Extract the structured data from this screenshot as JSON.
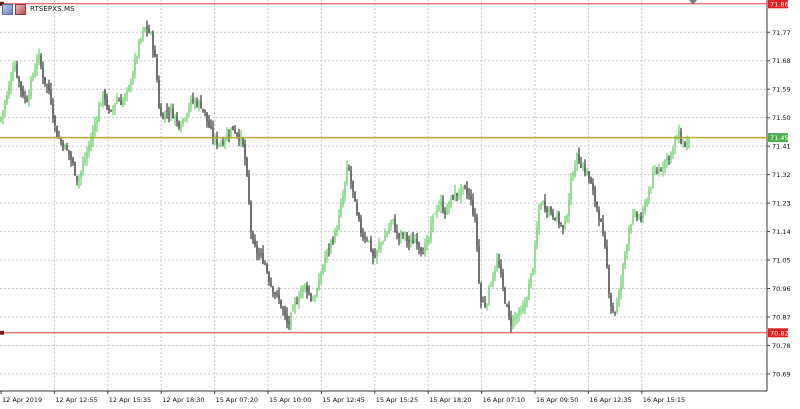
{
  "window": {
    "symbol": "RTSEPXS.MS"
  },
  "icons": {
    "symbol_icon": "chart-window-icon",
    "close_icon": "close-chart-icon"
  },
  "colors": {
    "background": "#ffffff",
    "grid": "#c7c7c7",
    "candle_up": "#4cc94c",
    "candle_down": "#111111",
    "resistance_line": "#e04040",
    "support_line": "#e04040",
    "bid_line": "#b8a43c",
    "bid_label_bg": "#4cae4c",
    "level_label_bg": "#e02020"
  },
  "price_axis": {
    "ticks": [
      "71.77",
      "71.68",
      "71.59",
      "71.50",
      "71.41",
      "71.32",
      "71.23",
      "71.14",
      "71.05",
      "70.96",
      "70.87",
      "70.78",
      "70.69"
    ],
    "range": [
      70.636,
      71.872
    ]
  },
  "time_axis": {
    "labels": [
      "12 Apr 2019",
      "12 Apr 12:55",
      "12 Apr 15:35",
      "12 Apr 18:30",
      "15 Apr 07:20",
      "15 Apr 10:00",
      "15 Apr 12:45",
      "15 Apr 15:25",
      "15 Apr 18:20",
      "16 Apr 07:10",
      "16 Apr 09:50",
      "16 Apr 12:35",
      "16 Apr 15:15"
    ]
  },
  "chart_data": {
    "type": "candlestick",
    "symbol": "RTSEPXS.MS",
    "ylim": [
      70.636,
      71.872
    ],
    "grid": true,
    "horizontal_lines": [
      {
        "price": 71.86,
        "label": "71.86"
      },
      {
        "price": 71.437,
        "label": "71.45"
      },
      {
        "price": 70.82,
        "label": "70.82"
      }
    ],
    "path": [
      [
        0,
        71.49
      ],
      [
        8,
        71.58
      ],
      [
        14,
        71.68
      ],
      [
        20,
        71.6
      ],
      [
        26,
        71.55
      ],
      [
        32,
        71.62
      ],
      [
        38,
        71.7
      ],
      [
        44,
        71.62
      ],
      [
        50,
        71.58
      ],
      [
        56,
        71.45
      ],
      [
        62,
        71.42
      ],
      [
        70,
        71.38
      ],
      [
        78,
        71.3
      ],
      [
        86,
        71.38
      ],
      [
        92,
        71.44
      ],
      [
        98,
        71.52
      ],
      [
        104,
        71.58
      ],
      [
        110,
        71.5
      ],
      [
        116,
        71.56
      ],
      [
        122,
        71.55
      ],
      [
        128,
        71.58
      ],
      [
        134,
        71.66
      ],
      [
        140,
        71.74
      ],
      [
        146,
        71.79
      ],
      [
        152,
        71.75
      ],
      [
        156,
        71.66
      ],
      [
        160,
        71.5
      ],
      [
        166,
        71.52
      ],
      [
        172,
        71.52
      ],
      [
        178,
        71.48
      ],
      [
        184,
        71.5
      ],
      [
        190,
        71.55
      ],
      [
        196,
        71.55
      ],
      [
        202,
        71.54
      ],
      [
        208,
        71.48
      ],
      [
        214,
        71.43
      ],
      [
        220,
        71.42
      ],
      [
        226,
        71.44
      ],
      [
        232,
        71.47
      ],
      [
        238,
        71.45
      ],
      [
        244,
        71.4
      ],
      [
        248,
        71.27
      ],
      [
        252,
        71.1
      ],
      [
        258,
        71.07
      ],
      [
        264,
        71.05
      ],
      [
        270,
        70.98
      ],
      [
        276,
        70.94
      ],
      [
        282,
        70.9
      ],
      [
        288,
        70.84
      ],
      [
        294,
        70.9
      ],
      [
        300,
        70.95
      ],
      [
        306,
        70.97
      ],
      [
        312,
        70.92
      ],
      [
        318,
        70.96
      ],
      [
        324,
        71.05
      ],
      [
        330,
        71.1
      ],
      [
        336,
        71.14
      ],
      [
        342,
        71.23
      ],
      [
        348,
        71.35
      ],
      [
        352,
        71.28
      ],
      [
        356,
        71.2
      ],
      [
        362,
        71.13
      ],
      [
        368,
        71.12
      ],
      [
        374,
        71.05
      ],
      [
        380,
        71.1
      ],
      [
        386,
        71.13
      ],
      [
        392,
        71.18
      ],
      [
        398,
        71.12
      ],
      [
        404,
        71.13
      ],
      [
        410,
        71.1
      ],
      [
        416,
        71.12
      ],
      [
        422,
        71.08
      ],
      [
        428,
        71.1
      ],
      [
        434,
        71.2
      ],
      [
        440,
        71.23
      ],
      [
        446,
        71.2
      ],
      [
        452,
        71.25
      ],
      [
        458,
        71.26
      ],
      [
        464,
        71.27
      ],
      [
        470,
        71.25
      ],
      [
        476,
        71.16
      ],
      [
        480,
        70.92
      ],
      [
        486,
        70.91
      ],
      [
        492,
        71.0
      ],
      [
        498,
        71.05
      ],
      [
        504,
        70.94
      ],
      [
        510,
        70.85
      ],
      [
        516,
        70.87
      ],
      [
        522,
        70.88
      ],
      [
        528,
        70.95
      ],
      [
        534,
        71.05
      ],
      [
        540,
        71.24
      ],
      [
        546,
        71.22
      ],
      [
        552,
        71.2
      ],
      [
        558,
        71.18
      ],
      [
        564,
        71.14
      ],
      [
        570,
        71.27
      ],
      [
        576,
        71.38
      ],
      [
        582,
        71.35
      ],
      [
        588,
        71.32
      ],
      [
        594,
        71.25
      ],
      [
        600,
        71.18
      ],
      [
        606,
        71.06
      ],
      [
        610,
        70.92
      ],
      [
        614,
        70.88
      ],
      [
        618,
        70.92
      ],
      [
        624,
        71.05
      ],
      [
        630,
        71.17
      ],
      [
        636,
        71.19
      ],
      [
        642,
        71.18
      ],
      [
        648,
        71.26
      ],
      [
        654,
        71.32
      ],
      [
        660,
        71.34
      ],
      [
        666,
        71.37
      ],
      [
        672,
        71.39
      ],
      [
        678,
        71.45
      ],
      [
        684,
        71.41
      ],
      [
        690,
        71.43
      ]
    ]
  }
}
